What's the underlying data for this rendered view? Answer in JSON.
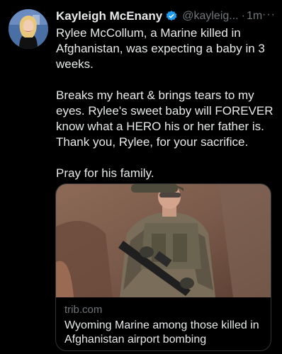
{
  "author": {
    "name": "Kayleigh McEnany",
    "handle": "@kayleig...",
    "separator": "·",
    "time": "1m",
    "more": "···"
  },
  "tweet": {
    "paragraphs": [
      "Rylee McCollum, a Marine killed in Afghanistan, was expecting a baby in 3 weeks.",
      "Breaks my heart & brings tears to my eyes. Rylee's sweet baby will FOREVER know what a HERO his or her father is. Thank you, Rylee, for your sacrifice.",
      "Pray for his family."
    ]
  },
  "card": {
    "domain": "trib.com",
    "title": "Wyoming Marine among those killed in Afghanistan airport bombing"
  },
  "colors": {
    "background": "#000000",
    "text": "#e7e9ea",
    "secondary": "#71767b",
    "verified": "#1d9bf0",
    "border": "#2f3336"
  },
  "icons": {
    "verified": "verified-badge-icon",
    "more": "more-dots-icon"
  }
}
